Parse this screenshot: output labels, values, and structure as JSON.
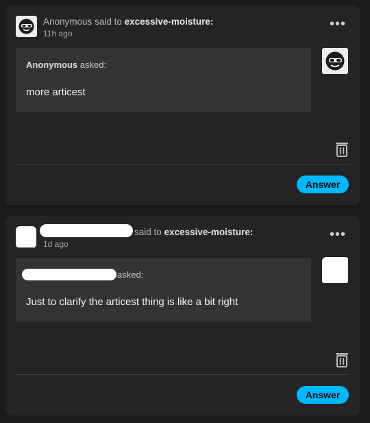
{
  "cards": [
    {
      "sender": "Anonymous",
      "said_to": "said to",
      "recipient": "excessive-moisture:",
      "time": "11h ago",
      "asker": "Anonymous",
      "asked_label": "asked:",
      "question": "more articest",
      "answer_label": "Answer",
      "menu_glyph": "•••",
      "avatar": "sunglasses-avatar-icon"
    },
    {
      "sender": "",
      "said_to": "said to",
      "recipient": "excessive-moisture:",
      "time": "1d ago",
      "asker": "",
      "asked_label": "asked:",
      "question": "Just to clarify the articest thing is like a bit right",
      "answer_label": "Answer",
      "menu_glyph": "•••",
      "avatar": "redacted-avatar"
    }
  ],
  "colors": {
    "background": "#1a1a1a",
    "card": "#242424",
    "bubble": "#333333",
    "accent": "#00b8ff"
  }
}
